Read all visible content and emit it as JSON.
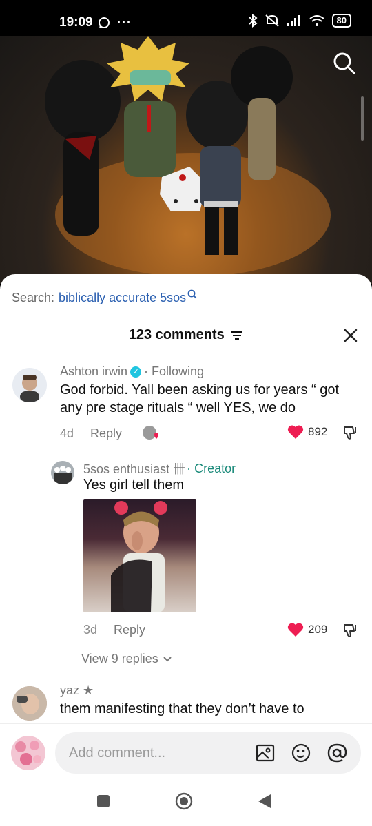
{
  "status_bar": {
    "time": "19:09",
    "icons_left": [
      "whatsapp-icon",
      "more-dots-icon"
    ],
    "icons_right": [
      "bluetooth-icon",
      "mute-icon",
      "signal-icon",
      "wifi-icon"
    ],
    "battery": "80"
  },
  "video": {
    "search_icon": "search-icon"
  },
  "search": {
    "prefix": "Search:",
    "query": "biblically accurate 5sos"
  },
  "comments": {
    "count_label": "123 comments",
    "items": [
      {
        "author": "Ashton irwin",
        "verified": true,
        "relation": "· Following",
        "text": "God forbid. Yall been asking us for years “ got any pre stage rituals “ well YES, we do",
        "age": "4d",
        "reply_label": "Reply",
        "likes": "892"
      }
    ],
    "reply": {
      "author": "5sos enthusiast 卌",
      "relation": "· Creator",
      "text": "Yes girl tell them",
      "age": "3d",
      "reply_label": "Reply",
      "likes": "209"
    },
    "view_replies": "View 9 replies",
    "next": {
      "author": "yaz ★",
      "text": "them manifesting that they don’t have to"
    }
  },
  "input": {
    "placeholder": "Add comment..."
  },
  "colors": {
    "heart": "#ee1d52",
    "link_blue": "#2a5fb0",
    "creator_teal": "#1a8a7a",
    "verified": "#20c5e0"
  }
}
